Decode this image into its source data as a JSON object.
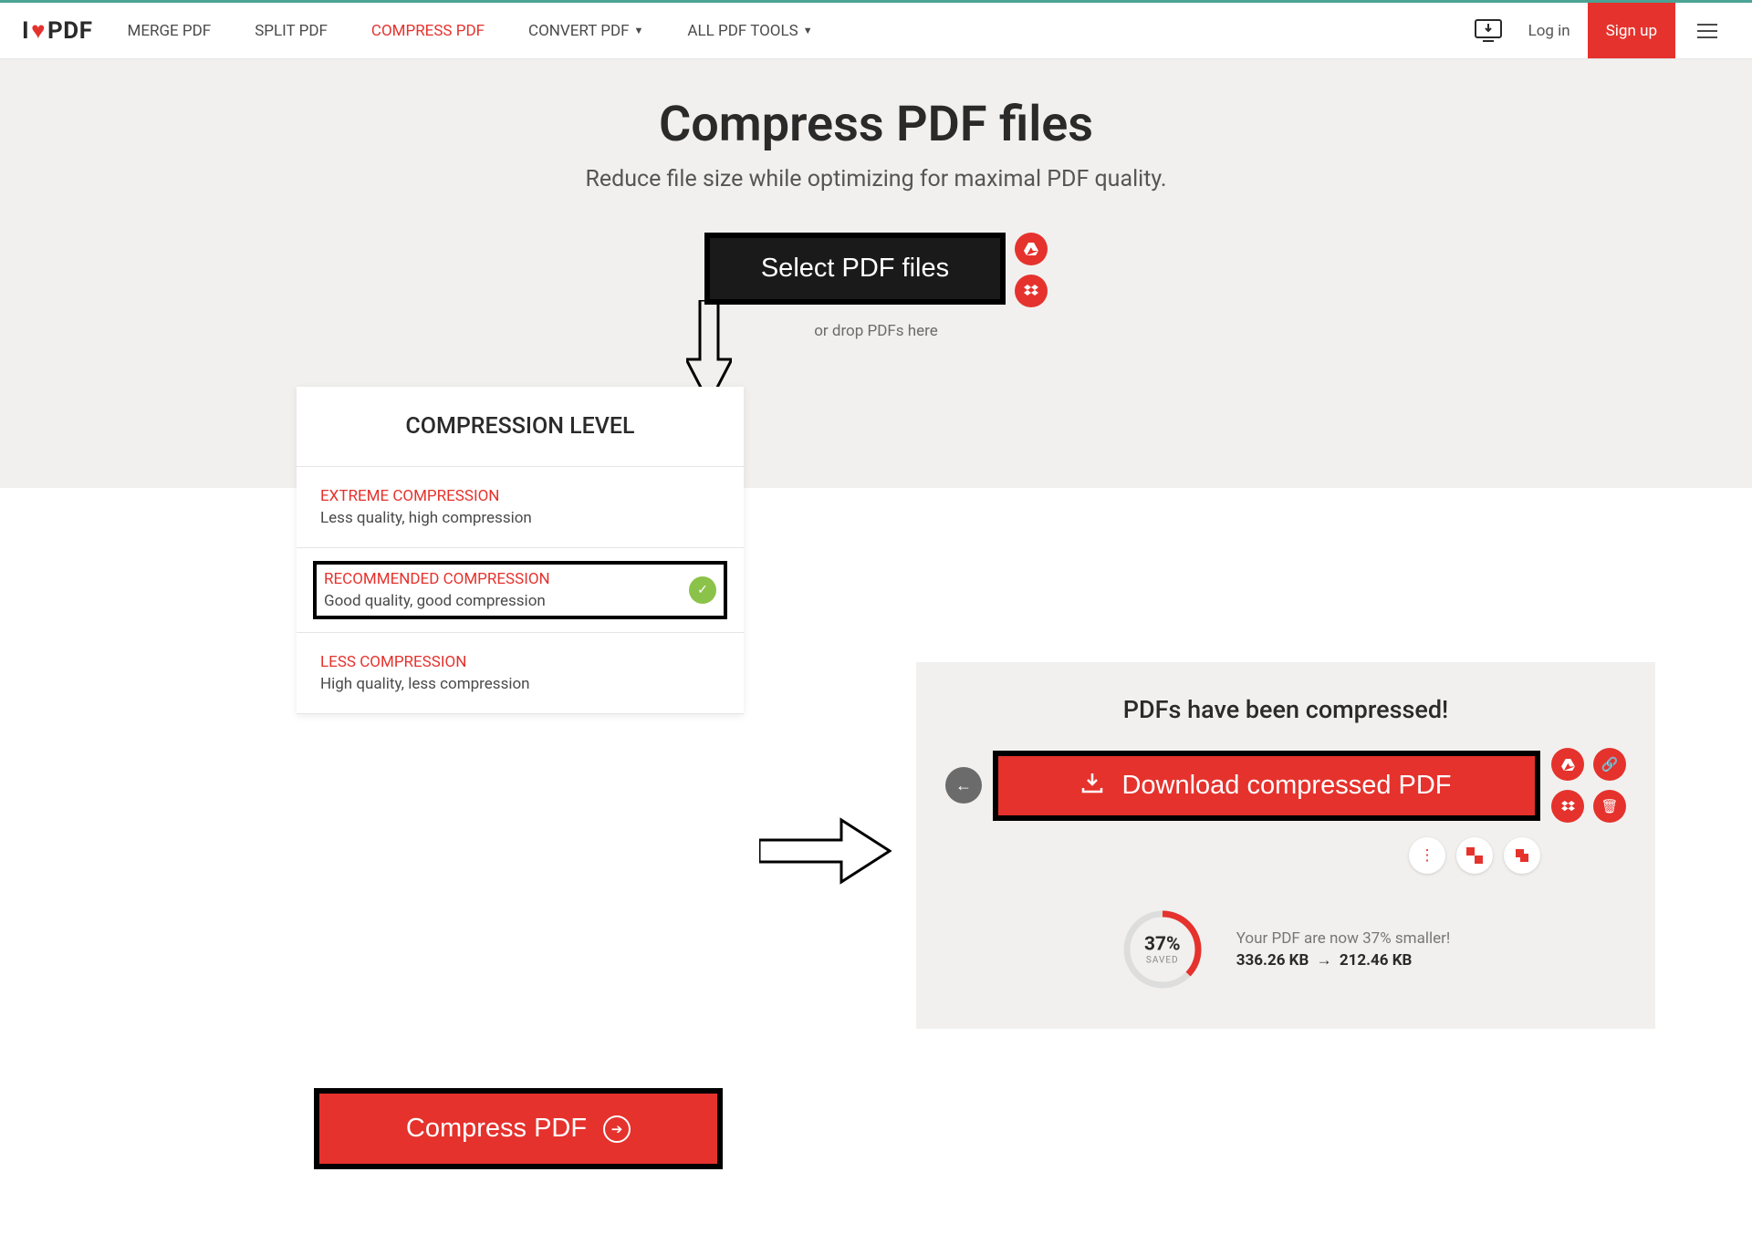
{
  "header": {
    "logo_i": "I",
    "logo_heart": "♥",
    "logo_pdf": "PDF",
    "nav": {
      "merge": "MERGE PDF",
      "split": "SPLIT PDF",
      "compress": "COMPRESS PDF",
      "convert": "CONVERT PDF",
      "all_tools": "ALL PDF TOOLS"
    },
    "login": "Log in",
    "signup": "Sign up"
  },
  "hero": {
    "title": "Compress PDF files",
    "subtitle": "Reduce file size while optimizing for maximal PDF quality.",
    "select_btn": "Select PDF files",
    "drop_hint": "or drop PDFs here"
  },
  "compression": {
    "panel_title": "COMPRESSION LEVEL",
    "levels": [
      {
        "title": "EXTREME COMPRESSION",
        "desc": "Less quality, high compression"
      },
      {
        "title": "RECOMMENDED COMPRESSION",
        "desc": "Good quality, good compression"
      },
      {
        "title": "LESS COMPRESSION",
        "desc": "High quality, less compression"
      }
    ]
  },
  "compress_btn": "Compress PDF",
  "result": {
    "title": "PDFs have been compressed!",
    "download": "Download compressed PDF",
    "pct": "37%",
    "saved": "SAVED",
    "line1": "Your PDF are now 37% smaller!",
    "before": "336.26 KB",
    "after": "212.46 KB"
  }
}
